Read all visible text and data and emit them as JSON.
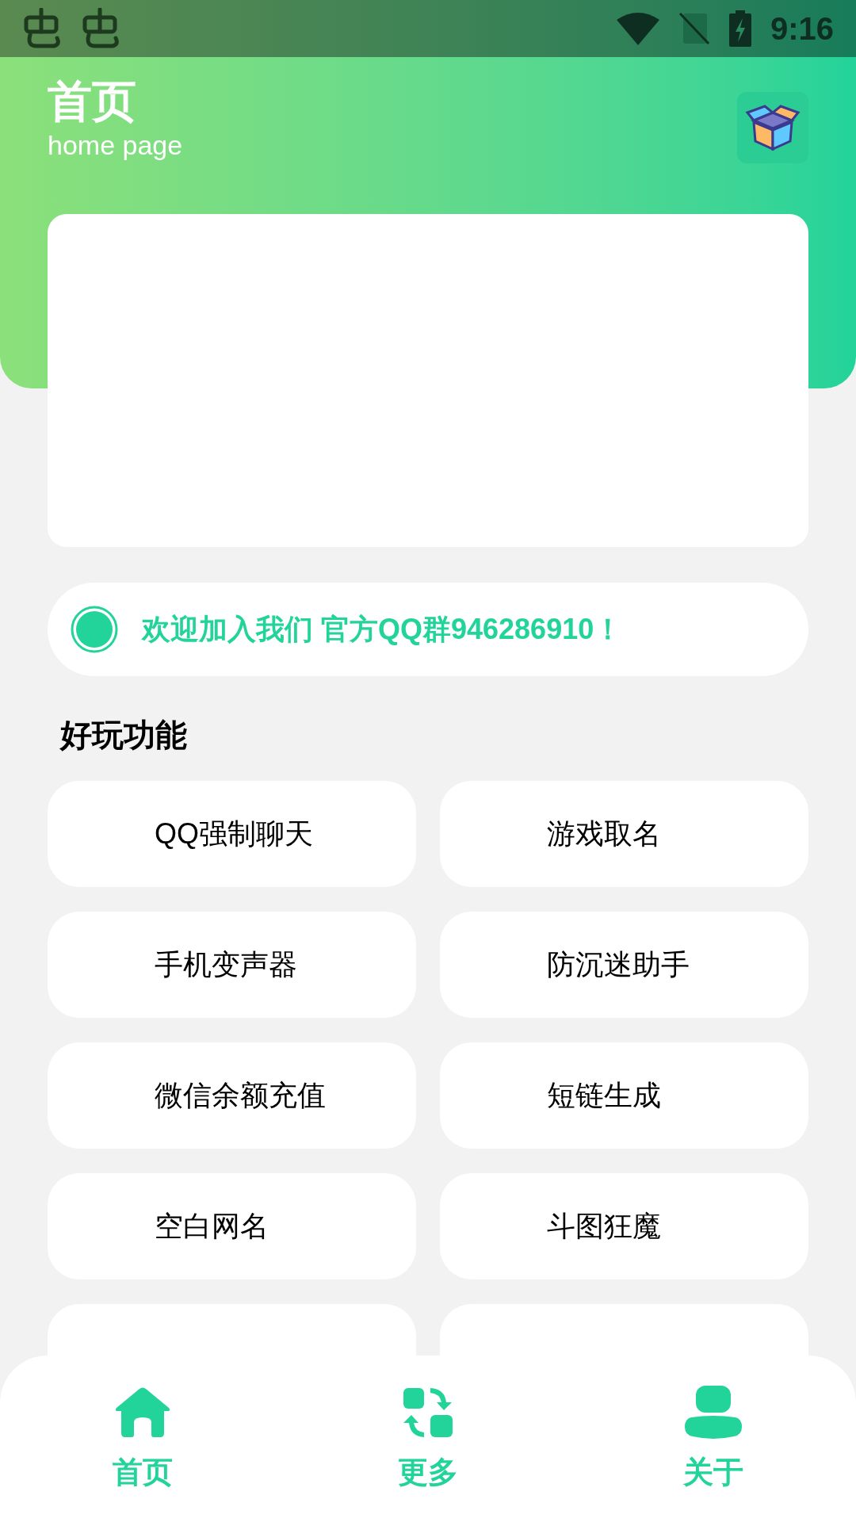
{
  "status_bar": {
    "time": "9:16"
  },
  "header": {
    "title": "首页",
    "subtitle": "home page"
  },
  "notice": {
    "text": "欢迎加入我们 官方QQ群946286910！"
  },
  "section": {
    "title": "好玩功能"
  },
  "features": [
    "QQ强制聊天",
    "游戏取名",
    "手机变声器",
    "防沉迷助手",
    "微信余额充值",
    "短链生成",
    "空白网名",
    "斗图狂魔"
  ],
  "bottom_nav": [
    {
      "label": "首页",
      "kind": "home"
    },
    {
      "label": "更多",
      "kind": "more"
    },
    {
      "label": "关于",
      "kind": "about"
    }
  ]
}
